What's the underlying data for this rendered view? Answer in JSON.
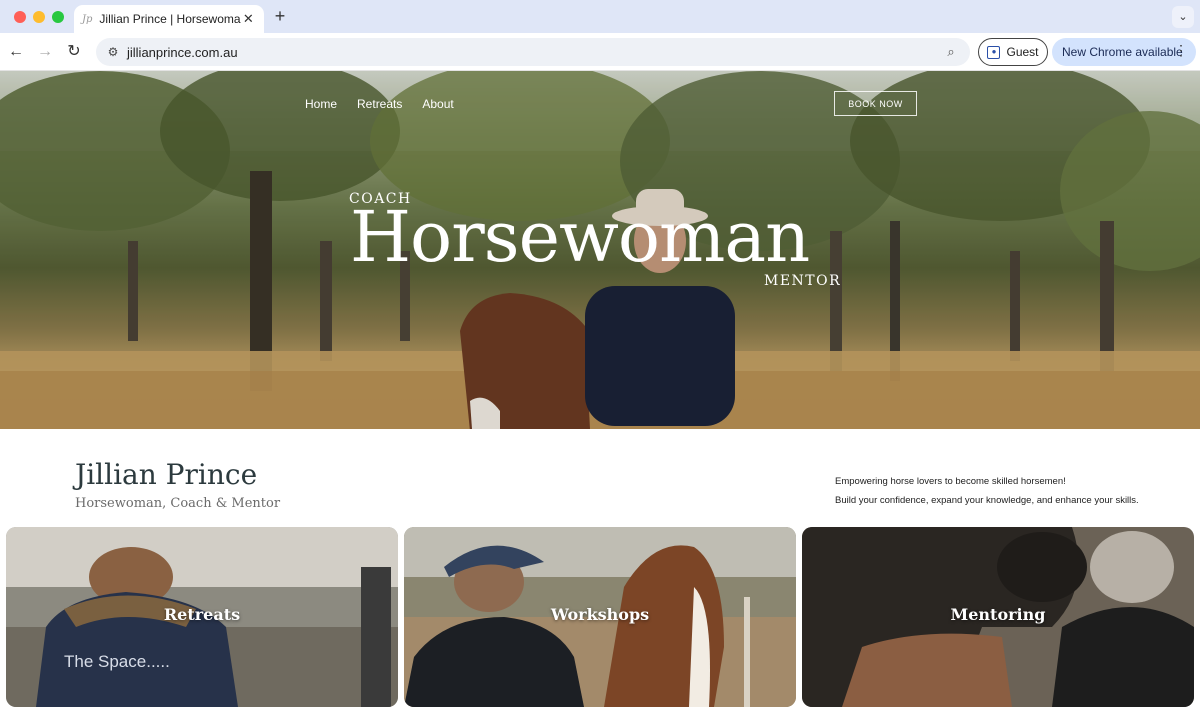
{
  "browser": {
    "tab_title": "Jillian Prince | Horsewoman, C",
    "tab_favicon": "Jp",
    "url": "jillianprince.com.au",
    "guest_label": "Guest",
    "update_label": "New Chrome available"
  },
  "hero": {
    "nav": [
      "Home",
      "Retreats",
      "About"
    ],
    "book_label": "BOOK NOW",
    "coach": "COACH",
    "title": "Horsewoman",
    "mentor": "MENTOR"
  },
  "intro": {
    "name": "Jillian Prince",
    "subtitle": "Horsewoman, Coach & Mentor",
    "line1": "Empowering horse lovers to become skilled horsemen!",
    "line2": "Build your confidence, expand your knowledge, and enhance your skills."
  },
  "cards": [
    {
      "label": "Retreats",
      "shirt_text": "The Space....."
    },
    {
      "label": "Workshops"
    },
    {
      "label": "Mentoring"
    }
  ],
  "colors": {
    "accent_dark": "#2c3a3e",
    "chrome_tabbar": "#dfe6f7",
    "update_pill": "#d3e3fd"
  }
}
